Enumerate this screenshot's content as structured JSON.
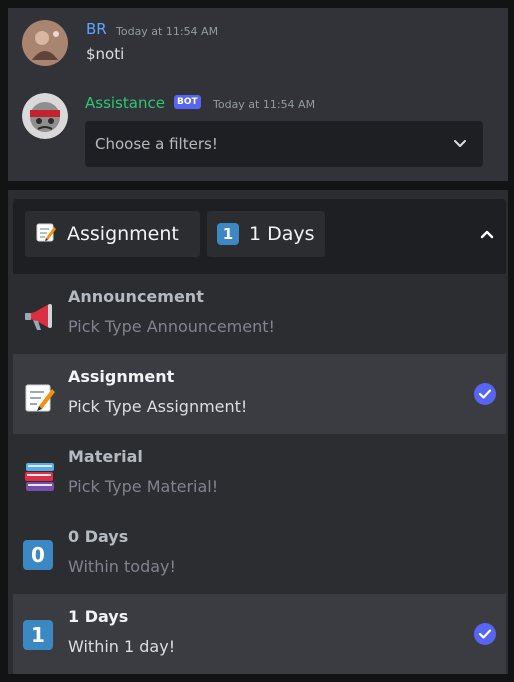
{
  "messages": [
    {
      "author": "BR",
      "author_color": "#5ea5ff",
      "timestamp": "Today at 11:54 AM",
      "content": "$noti"
    },
    {
      "author": "Assistance",
      "author_color": "#2dc770",
      "bot_tag": "BOT",
      "timestamp": "Today at 11:54 AM"
    }
  ],
  "select_collapsed": {
    "placeholder": "Choose a filters!"
  },
  "select_open": {
    "chips": [
      {
        "label": "Assignment",
        "icon": "memo-icon"
      },
      {
        "label": "1 Days",
        "icon": "keycap-one-icon"
      }
    ],
    "options": [
      {
        "title": "Announcement",
        "desc": "Pick Type Announcement!",
        "icon": "megaphone-icon",
        "selected": false
      },
      {
        "title": "Assignment",
        "desc": "Pick Type Assignment!",
        "icon": "memo-icon",
        "selected": true
      },
      {
        "title": "Material",
        "desc": "Pick Type Material!",
        "icon": "books-icon",
        "selected": false
      },
      {
        "title": "0 Days",
        "desc": "Within today!",
        "icon": "keycap-zero-icon",
        "keycap": "0",
        "selected": false
      },
      {
        "title": "1 Days",
        "desc": "Within 1 day!",
        "icon": "keycap-one-icon",
        "keycap": "1",
        "selected": true
      }
    ]
  },
  "colors": {
    "accent": "#5865f2",
    "panel": "#313338",
    "select_bg": "#1e1f22",
    "selected_row": "#3a3c42"
  }
}
